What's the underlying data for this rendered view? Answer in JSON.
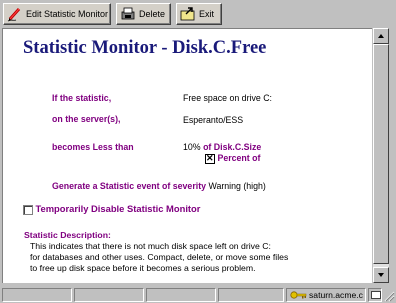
{
  "toolbar": {
    "edit_label": "Edit Statistic Monitor",
    "delete_label": "Delete",
    "exit_label": "Exit"
  },
  "page": {
    "title": "Statistic Monitor - Disk.C.Free"
  },
  "form": {
    "if_label": "If the statistic,",
    "if_value": "Free space on drive C:",
    "server_label": "on the server(s),",
    "server_value": "Esperanto/ESS",
    "becomes_label": "becomes Less than",
    "threshold_value": "10%",
    "threshold_of": "of Disk.C.Size",
    "percent_checked": true,
    "percent_label": "Percent of",
    "event_label": "Generate a Statistic event of severity",
    "event_value": "Warning (high)",
    "disable_label": "Temporarily Disable Statistic Monitor"
  },
  "description": {
    "heading": "Statistic Description:",
    "lines": [
      "This indicates that there is not much disk space left on drive C:",
      "for databases and other uses. Compact, delete, or move some files",
      "to free up disk space before it becomes a serious problem."
    ]
  },
  "status": {
    "host": "saturn.acme.com"
  },
  "icons": {
    "edit": "pencil-icon",
    "delete": "delete-icon",
    "exit": "exit-icon",
    "key": "key-icon"
  },
  "colors": {
    "title": "#1a1a7a",
    "label": "#800080",
    "chrome": "#c0c0c0"
  }
}
